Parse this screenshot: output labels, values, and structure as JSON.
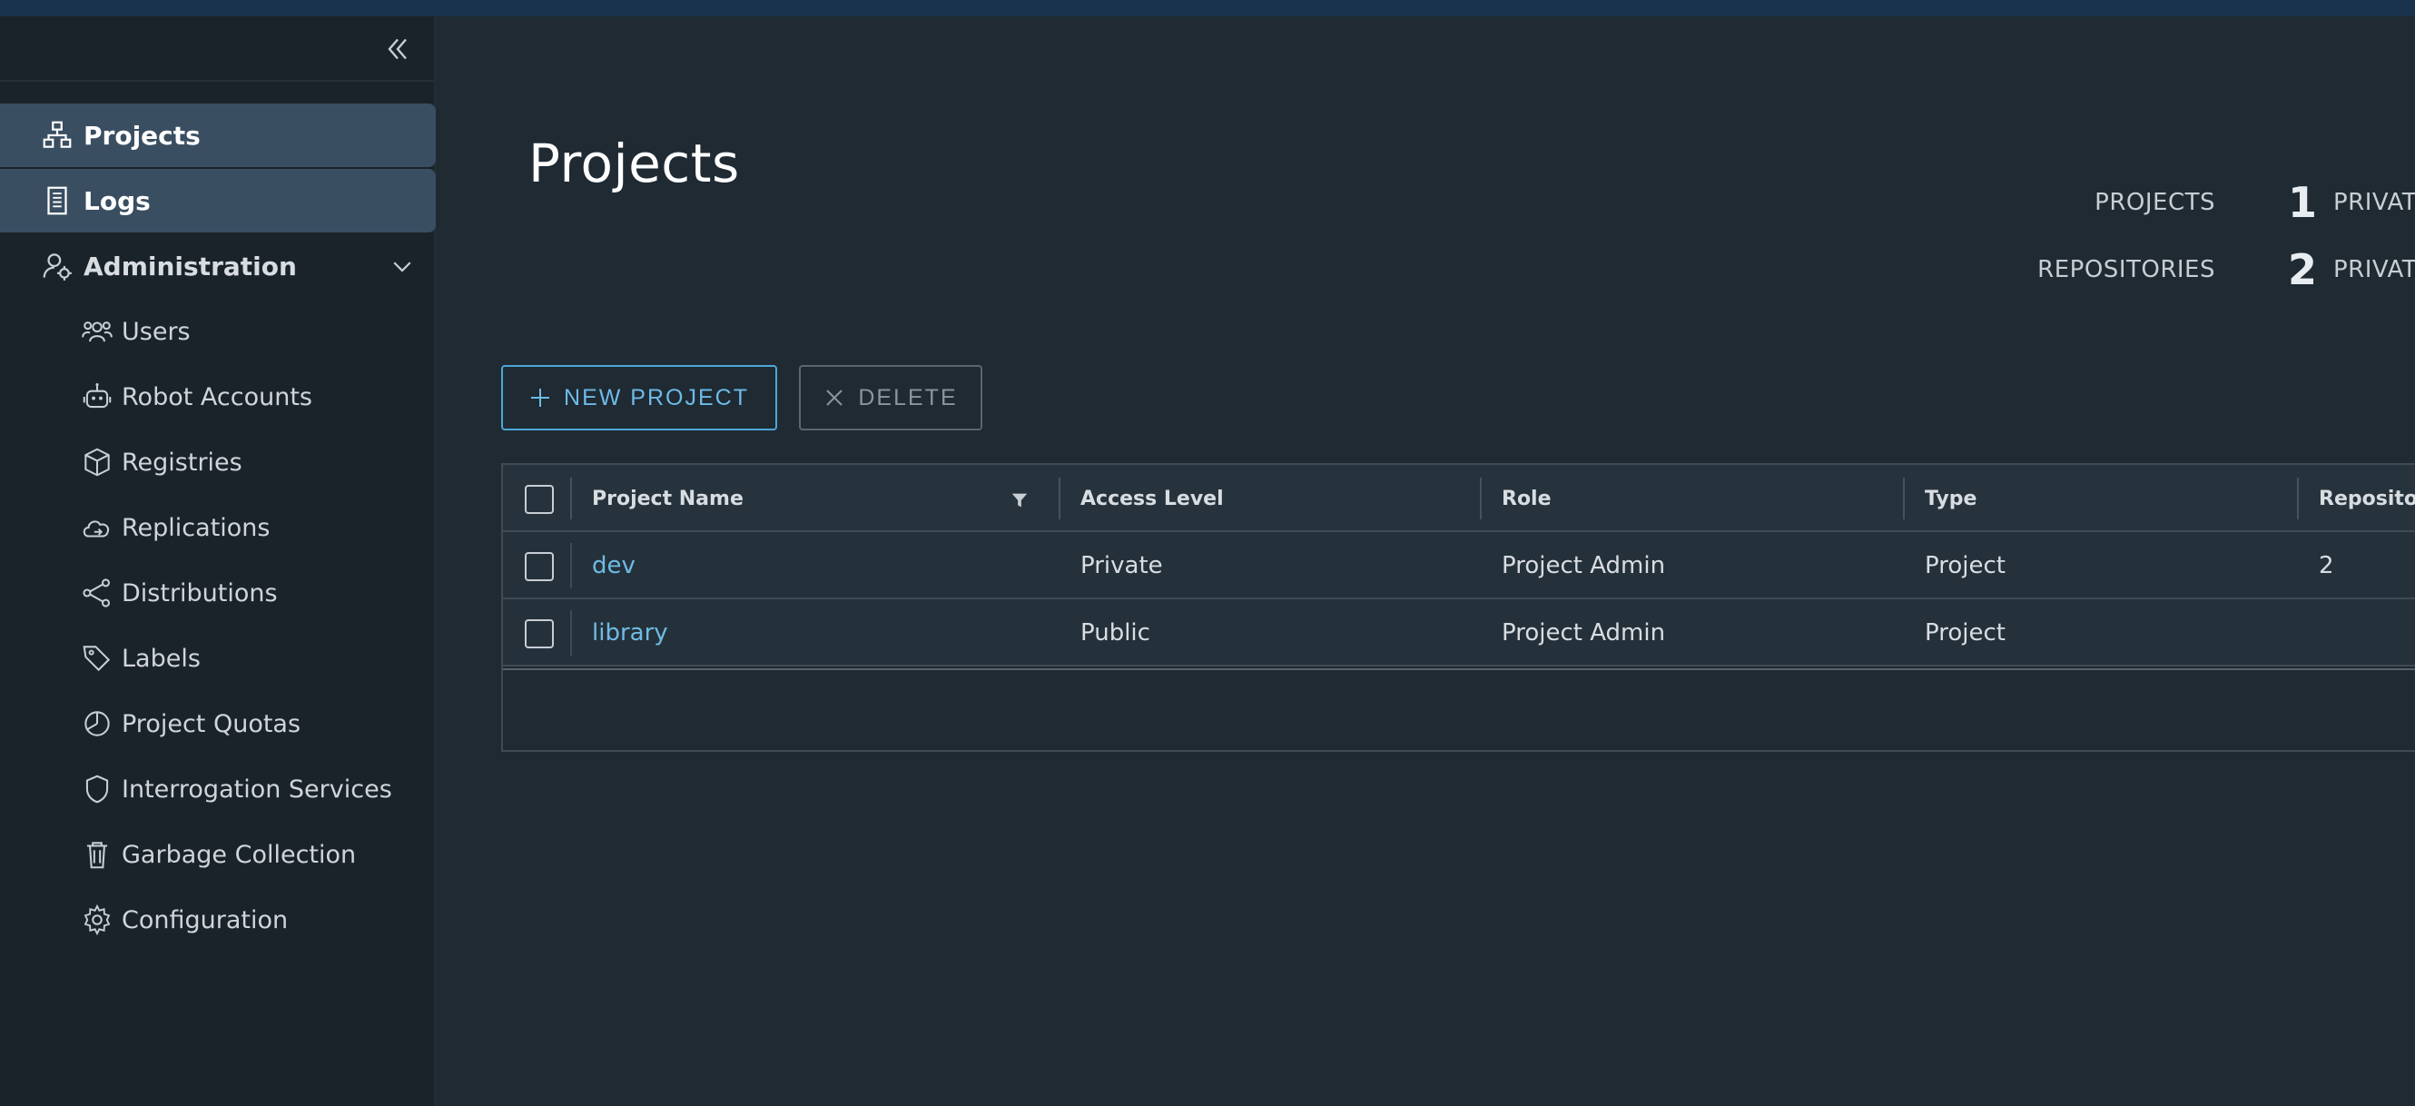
{
  "sidebar": {
    "items": [
      {
        "label": "Projects",
        "icon": "projects-icon",
        "active": true
      },
      {
        "label": "Logs",
        "icon": "logs-icon",
        "active": true
      },
      {
        "label": "Administration",
        "icon": "admin-icon",
        "expanded": true
      },
      {
        "label": "Users",
        "icon": "users-icon"
      },
      {
        "label": "Robot Accounts",
        "icon": "robot-icon"
      },
      {
        "label": "Registries",
        "icon": "registries-icon"
      },
      {
        "label": "Replications",
        "icon": "replications-icon"
      },
      {
        "label": "Distributions",
        "icon": "distributions-icon"
      },
      {
        "label": "Labels",
        "icon": "labels-icon"
      },
      {
        "label": "Project Quotas",
        "icon": "quotas-icon"
      },
      {
        "label": "Interrogation Services",
        "icon": "interrogation-icon"
      },
      {
        "label": "Garbage Collection",
        "icon": "trash-icon"
      },
      {
        "label": "Configuration",
        "icon": "gear-icon"
      }
    ]
  },
  "main": {
    "title": "Projects",
    "summary": [
      {
        "label": "PROJECTS",
        "count": "1",
        "sub": "PRIVAT"
      },
      {
        "label": "REPOSITORIES",
        "count": "2",
        "sub": "PRIVAT"
      }
    ],
    "toolbar": {
      "new_label": "NEW PROJECT",
      "delete_label": "DELETE"
    },
    "table": {
      "columns": [
        "Project Name",
        "Access Level",
        "Role",
        "Type",
        "Repositor"
      ],
      "rows": [
        {
          "name": "dev",
          "access": "Private",
          "role": "Project Admin",
          "type": "Project",
          "repos": "2"
        },
        {
          "name": "library",
          "access": "Public",
          "role": "Project Admin",
          "type": "Project",
          "repos": ""
        }
      ]
    }
  },
  "colors": {
    "accent": "#4fa6d9",
    "background": "#1f2a33",
    "sidebar": "#1b232a",
    "active_item": "#3a4e61"
  }
}
